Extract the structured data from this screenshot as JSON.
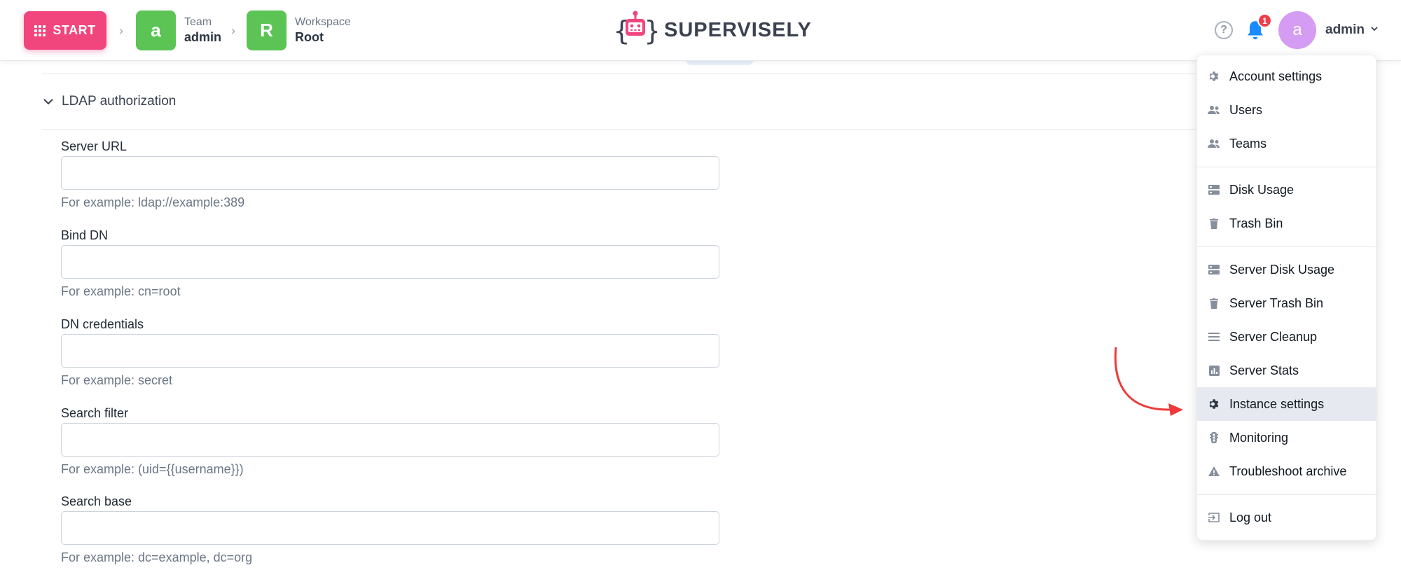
{
  "header": {
    "start_label": "START",
    "breadcrumbs": [
      {
        "letter": "a",
        "label": "Team",
        "value": "admin"
      },
      {
        "letter": "R",
        "label": "Workspace",
        "value": "Root"
      }
    ],
    "logo_text": "SUPERVISELY",
    "notification_count": "1",
    "avatar_letter": "a",
    "username": "admin"
  },
  "section": {
    "title": "LDAP authorization",
    "fields": [
      {
        "label": "Server URL",
        "value": "",
        "hint": "For example: ldap://example:389"
      },
      {
        "label": "Bind DN",
        "value": "",
        "hint": "For example: cn=root"
      },
      {
        "label": "DN credentials",
        "value": "",
        "hint": "For example: secret"
      },
      {
        "label": "Search filter",
        "value": "",
        "hint": "For example: (uid={{username}})"
      },
      {
        "label": "Search base",
        "value": "",
        "hint": "For example: dc=example, dc=org"
      }
    ]
  },
  "menu": {
    "items": [
      {
        "label": "Account settings",
        "icon": "gear-icon"
      },
      {
        "label": "Users",
        "icon": "users-icon"
      },
      {
        "label": "Teams",
        "icon": "teams-icon"
      },
      {
        "label": "Disk Usage",
        "icon": "storage-icon"
      },
      {
        "label": "Trash Bin",
        "icon": "trash-icon"
      },
      {
        "label": "Server Disk Usage",
        "icon": "storage-icon"
      },
      {
        "label": "Server Trash Bin",
        "icon": "trash-icon"
      },
      {
        "label": "Server Cleanup",
        "icon": "list-icon"
      },
      {
        "label": "Server Stats",
        "icon": "stats-icon"
      },
      {
        "label": "Instance settings",
        "icon": "gear-icon",
        "active": true
      },
      {
        "label": "Monitoring",
        "icon": "monitoring-icon"
      },
      {
        "label": "Troubleshoot archive",
        "icon": "warning-icon"
      },
      {
        "label": "Log out",
        "icon": "logout-icon"
      }
    ]
  },
  "colors": {
    "accent": "#f0457d",
    "crumb": "#5bc454",
    "avatar": "#d49cf2",
    "badge": "#ef3e4a",
    "arrow": "#ee3a3a"
  }
}
